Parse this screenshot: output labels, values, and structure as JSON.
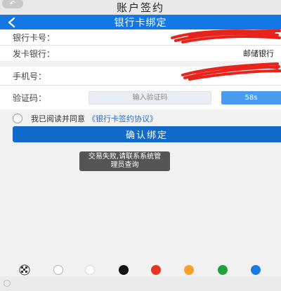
{
  "outer": {
    "title": "账户签约",
    "corner_icon": "undo-icon",
    "corner_symbol": "↶"
  },
  "header": {
    "title": "银行卡绑定",
    "back_icon": "chevron-left-icon",
    "color": "#1477e6"
  },
  "form": {
    "card_number_label": "银行卡号：",
    "bank_label": "发卡银行：",
    "bank_value": "邮储银行",
    "phone_label": "手机号：",
    "code_label": "验证码：",
    "code_placeholder": "输入验证码",
    "countdown_text": "58s"
  },
  "agreement": {
    "prefix": "我已阅读并同意",
    "link": "《银行卡签约协议》",
    "checked": false
  },
  "confirm_button": "确认绑定",
  "toast": {
    "line1": "交易失败,请联系系统管",
    "line2": "理员查询"
  },
  "annotation_palette": {
    "tools": [
      {
        "name": "mosaic-tool",
        "color": "#333333"
      },
      {
        "name": "color-gray",
        "color": "#b5b5b5"
      },
      {
        "name": "color-white",
        "color": "#ffffff"
      },
      {
        "name": "color-black",
        "color": "#111111"
      },
      {
        "name": "color-red",
        "color": "#e53524"
      },
      {
        "name": "color-orange",
        "color": "#f7a12a"
      },
      {
        "name": "color-green",
        "color": "#1fa33a"
      },
      {
        "name": "color-blue",
        "color": "#1b7be0"
      }
    ],
    "selected": "color-red"
  },
  "colors": {
    "redaction": "#e8231b",
    "link": "#1d6fd8",
    "button": "#1169c9"
  }
}
